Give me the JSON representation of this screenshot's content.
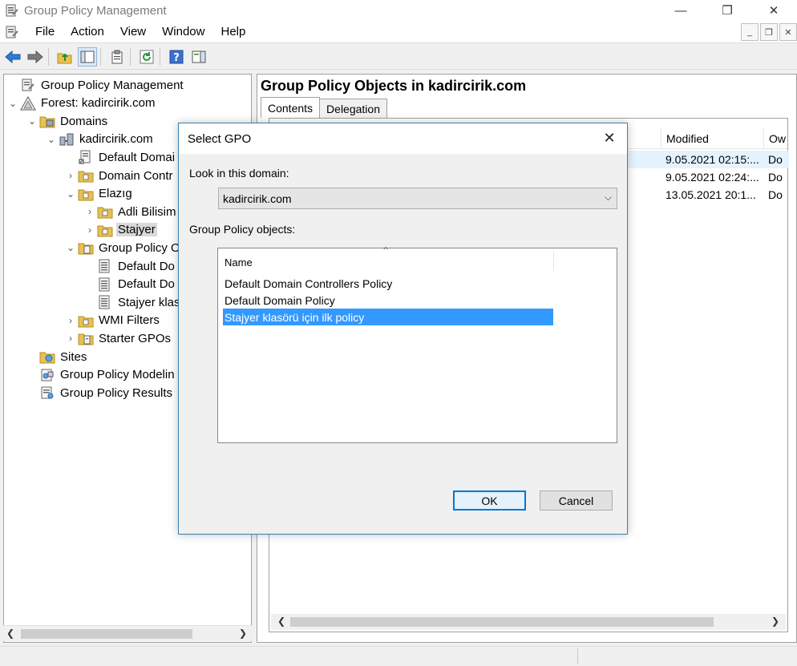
{
  "window": {
    "title": "Group Policy Management",
    "controls": {
      "minimize": "—",
      "maximize": "❐",
      "close": "✕"
    }
  },
  "menu": {
    "items": [
      "File",
      "Action",
      "View",
      "Window",
      "Help"
    ],
    "mdi_controls": {
      "minimize": "_",
      "restore": "❐",
      "close": "✕"
    }
  },
  "tree": {
    "items": [
      {
        "label": "Group Policy Management",
        "icon": "gpm-icon",
        "expander": ""
      },
      {
        "label": "Forest: kadircirik.com",
        "icon": "forest-icon",
        "expander": "⌄"
      },
      {
        "label": "Domains",
        "icon": "domains-folder-icon",
        "expander": "⌄"
      },
      {
        "label": "kadircirik.com",
        "icon": "domain-icon",
        "expander": "⌄"
      },
      {
        "label": "Default Domai",
        "icon": "gpo-link-icon",
        "expander": ""
      },
      {
        "label": "Domain Contr",
        "icon": "ou-icon",
        "expander": "›"
      },
      {
        "label": "Elazıg",
        "icon": "ou-icon",
        "expander": "⌄"
      },
      {
        "label": "Adli Bilisim",
        "icon": "ou-icon",
        "expander": "›"
      },
      {
        "label": "Stajyer",
        "icon": "ou-icon",
        "expander": "›"
      },
      {
        "label": "Group Policy O",
        "icon": "gpo-folder-icon",
        "expander": "⌄"
      },
      {
        "label": "Default Do",
        "icon": "gpo-icon",
        "expander": ""
      },
      {
        "label": "Default Do",
        "icon": "gpo-icon",
        "expander": ""
      },
      {
        "label": "Stajyer klas",
        "icon": "gpo-icon",
        "expander": ""
      },
      {
        "label": "WMI Filters",
        "icon": "ou-icon",
        "expander": "›"
      },
      {
        "label": "Starter GPOs",
        "icon": "starter-folder-icon",
        "expander": "›"
      },
      {
        "label": "Sites",
        "icon": "sites-icon",
        "expander": ""
      },
      {
        "label": "Group Policy Modelin",
        "icon": "modeling-icon",
        "expander": ""
      },
      {
        "label": "Group Policy Results",
        "icon": "results-icon",
        "expander": ""
      }
    ]
  },
  "right_pane": {
    "title": "Group Policy Objects in kadircirik.com",
    "tabs": [
      "Contents",
      "Delegation"
    ],
    "columns": {
      "modified": "Modified",
      "owner": "Ow"
    },
    "rows": [
      {
        "modified": "9.05.2021 02:15:...",
        "owner": "Do"
      },
      {
        "modified": "9.05.2021 02:24:...",
        "owner": "Do"
      },
      {
        "modified": "13.05.2021 20:1...",
        "owner": "Do"
      }
    ]
  },
  "dialog": {
    "title": "Select GPO",
    "close": "✕",
    "domain_label": "Look in this domain:",
    "domain_value": "kadircirik.com",
    "list_label": "Group Policy objects:",
    "list_header": "Name",
    "gpos": [
      "Default Domain Controllers Policy",
      "Default Domain Policy",
      "Stajyer klasörü için ilk policy"
    ],
    "ok_label": "OK",
    "cancel_label": "Cancel"
  },
  "colors": {
    "selection": "#3399ff",
    "dialog_border": "#3c7fb1",
    "default_button": "#0078d7"
  }
}
